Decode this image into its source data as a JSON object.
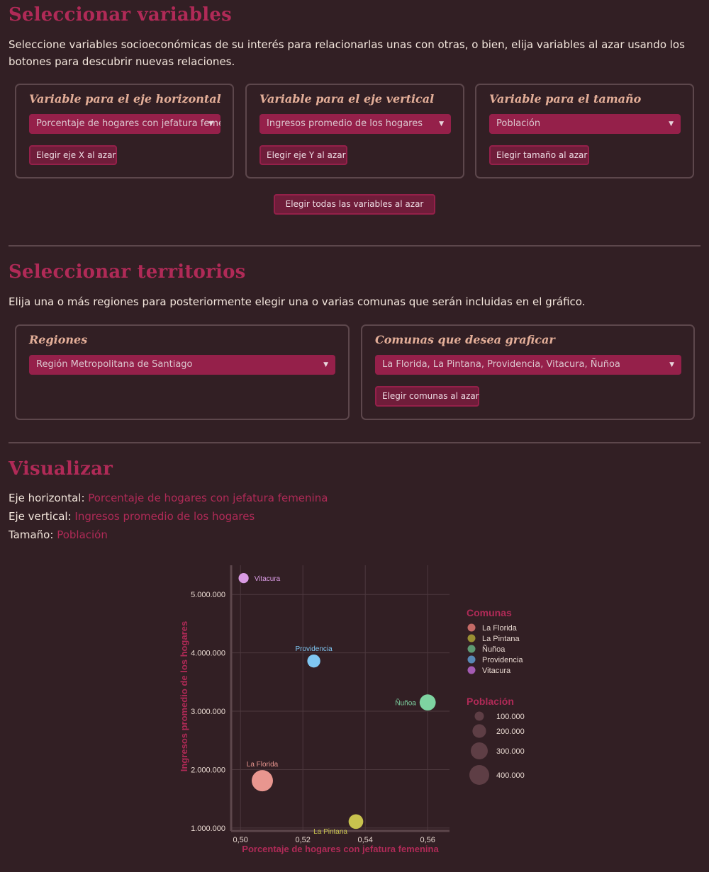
{
  "select_vars": {
    "title": "Seleccionar variables",
    "description": "Seleccione variables socioeconómicas de su interés para relacionarlas unas con otras, o bien, elija variables al azar usando los botones para descubrir nuevas relaciones.",
    "x_box": {
      "label": "Variable para el eje horizontal",
      "value": "Porcentaje de hogares con jefatura femenina",
      "button": "Elegir eje X al azar"
    },
    "y_box": {
      "label": "Variable para el eje vertical",
      "value": "Ingresos promedio de los hogares",
      "button": "Elegir eje Y al azar"
    },
    "size_box": {
      "label": "Variable para el tamaño",
      "value": "Población",
      "button": "Elegir tamaño al azar"
    },
    "random_all_button": "Elegir todas las variables al azar"
  },
  "select_territories": {
    "title": "Seleccionar territorios",
    "description": "Elija una o más regiones para posteriormente elegir una o varias comunas que serán incluidas en el gráfico.",
    "regions_box": {
      "label": "Regiones",
      "value": "Región Metropolitana de Santiago"
    },
    "comunas_box": {
      "label": "Comunas que desea graficar",
      "value": "La Florida, La Pintana, Providencia, Vitacura, Ñuñoa",
      "button": "Elegir comunas al azar"
    }
  },
  "visualize": {
    "title": "Visualizar",
    "x_prefix": "Eje horizontal:",
    "x_value": "Porcentaje de hogares con jefatura femenina",
    "y_prefix": "Eje vertical:",
    "y_value": "Ingresos promedio de los hogares",
    "size_prefix": "Tamaño:",
    "size_value": "Población"
  },
  "chart_data": {
    "type": "scatter",
    "xlabel": "Porcentaje de hogares con jefatura femenina",
    "ylabel": "Ingresos promedio de los hogares",
    "xlim": [
      0.497,
      0.567
    ],
    "ylim": [
      950000,
      5500000
    ],
    "x_ticks": [
      0.5,
      0.52,
      0.54,
      0.56
    ],
    "x_tick_labels": [
      "0,50",
      "0,52",
      "0,54",
      "0,56"
    ],
    "y_ticks": [
      1000000,
      2000000,
      3000000,
      4000000,
      5000000
    ],
    "y_tick_labels": [
      "1.000.000",
      "2.000.000",
      "3.000.000",
      "4.000.000",
      "5.000.000"
    ],
    "grid": true,
    "points": [
      {
        "name": "La Florida",
        "x": 0.507,
        "y": 1810000,
        "size": 400000,
        "color": "#e8968f",
        "legend_color": "#c56a66"
      },
      {
        "name": "La Pintana",
        "x": 0.537,
        "y": 1110000,
        "size": 190000,
        "color": "#c8c24e",
        "legend_color": "#9a8f33"
      },
      {
        "name": "Ñuñoa",
        "x": 0.56,
        "y": 3150000,
        "size": 230000,
        "color": "#7ed3a1",
        "legend_color": "#5e9a73"
      },
      {
        "name": "Providencia",
        "x": 0.5235,
        "y": 3860000,
        "size": 150000,
        "color": "#7fc6f2",
        "legend_color": "#5888b5"
      },
      {
        "name": "Vitacura",
        "x": 0.501,
        "y": 5280000,
        "size": 90000,
        "color": "#d99be3",
        "legend_color": "#a45bb3"
      }
    ],
    "legend_color": {
      "title": "Comunas",
      "items": [
        "La Florida",
        "La Pintana",
        "Ñuñoa",
        "Providencia",
        "Vitacura"
      ]
    },
    "legend_size": {
      "title": "Población",
      "items": [
        {
          "label": "100.000",
          "value": 100000
        },
        {
          "label": "200.000",
          "value": 200000
        },
        {
          "label": "300.000",
          "value": 300000
        },
        {
          "label": "400.000",
          "value": 400000
        }
      ]
    },
    "colors": {
      "axis_title": "#b02a57",
      "tick_label": "#e8d8d0",
      "grid": "#4d393e",
      "axis": "#5d474c",
      "size_swatch": "#5e3e45"
    }
  }
}
